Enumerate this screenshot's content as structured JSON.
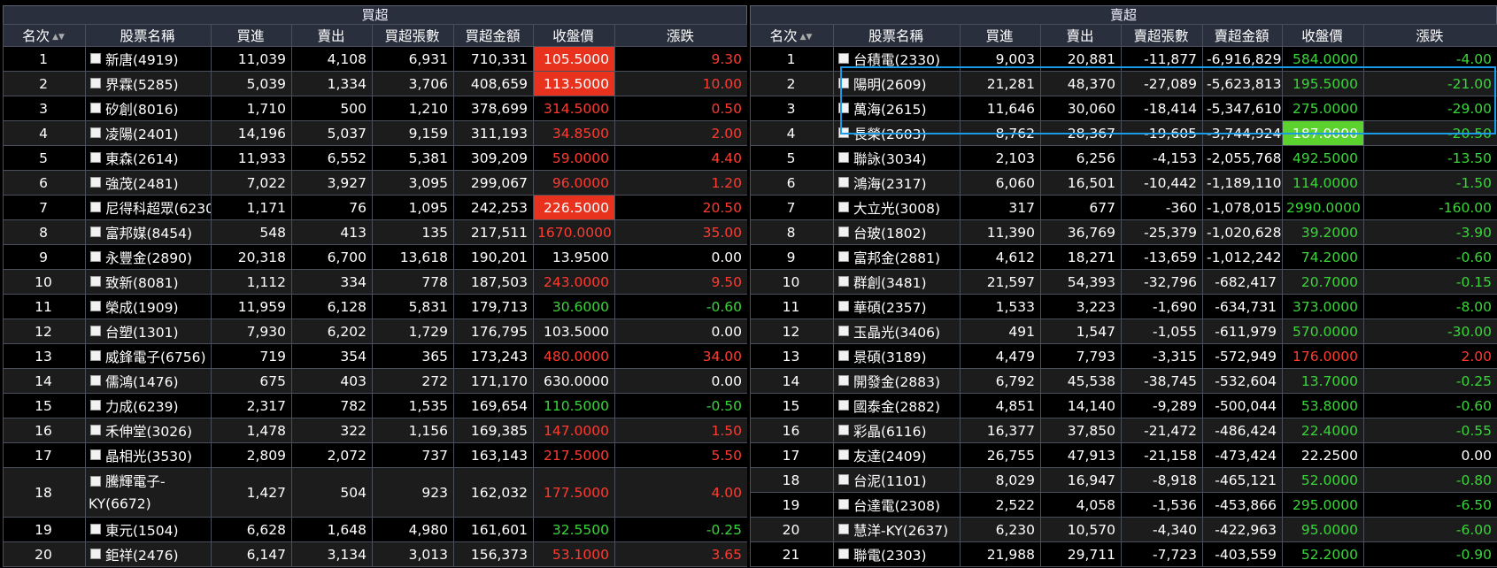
{
  "buy": {
    "title": "買超",
    "headers": [
      "名次",
      "股票名稱",
      "買進",
      "賣出",
      "買超張數",
      "買超金額",
      "收盤價",
      "漲跌"
    ],
    "rows": [
      {
        "rank": "1",
        "name": "新唐(4919)",
        "buy": "11,039",
        "sell": "4,108",
        "net": "6,931",
        "amount": "710,331",
        "close": "105.5000",
        "change": "9.30",
        "color": "red",
        "hl": true
      },
      {
        "rank": "2",
        "name": "界霖(5285)",
        "buy": "5,039",
        "sell": "1,334",
        "net": "3,706",
        "amount": "408,659",
        "close": "113.5000",
        "change": "10.00",
        "color": "red",
        "hl": true
      },
      {
        "rank": "3",
        "name": "矽創(8016)",
        "buy": "1,710",
        "sell": "500",
        "net": "1,210",
        "amount": "378,699",
        "close": "314.5000",
        "change": "0.50",
        "color": "red",
        "hl": false
      },
      {
        "rank": "4",
        "name": "凌陽(2401)",
        "buy": "14,196",
        "sell": "5,037",
        "net": "9,159",
        "amount": "311,193",
        "close": "34.8500",
        "change": "2.00",
        "color": "red",
        "hl": false
      },
      {
        "rank": "5",
        "name": "東森(2614)",
        "buy": "11,933",
        "sell": "6,552",
        "net": "5,381",
        "amount": "309,209",
        "close": "59.0000",
        "change": "4.40",
        "color": "red",
        "hl": false
      },
      {
        "rank": "6",
        "name": "強茂(2481)",
        "buy": "7,022",
        "sell": "3,927",
        "net": "3,095",
        "amount": "299,067",
        "close": "96.0000",
        "change": "1.20",
        "color": "red",
        "hl": false
      },
      {
        "rank": "7",
        "name": "尼得科超眾(6230)",
        "buy": "1,171",
        "sell": "76",
        "net": "1,095",
        "amount": "242,253",
        "close": "226.5000",
        "change": "20.50",
        "color": "red",
        "hl": true
      },
      {
        "rank": "8",
        "name": "富邦媒(8454)",
        "buy": "548",
        "sell": "413",
        "net": "135",
        "amount": "217,511",
        "close": "1670.0000",
        "change": "35.00",
        "color": "red",
        "hl": false
      },
      {
        "rank": "9",
        "name": "永豐金(2890)",
        "buy": "20,318",
        "sell": "6,700",
        "net": "13,618",
        "amount": "190,201",
        "close": "13.9500",
        "change": "0.00",
        "color": "white",
        "hl": false
      },
      {
        "rank": "10",
        "name": "致新(8081)",
        "buy": "1,112",
        "sell": "334",
        "net": "778",
        "amount": "187,503",
        "close": "243.0000",
        "change": "9.50",
        "color": "red",
        "hl": false
      },
      {
        "rank": "11",
        "name": "榮成(1909)",
        "buy": "11,959",
        "sell": "6,128",
        "net": "5,831",
        "amount": "179,713",
        "close": "30.6000",
        "change": "-0.60",
        "color": "green",
        "hl": false
      },
      {
        "rank": "12",
        "name": "台塑(1301)",
        "buy": "7,930",
        "sell": "6,202",
        "net": "1,729",
        "amount": "176,795",
        "close": "103.5000",
        "change": "0.00",
        "color": "white",
        "hl": false
      },
      {
        "rank": "13",
        "name": "威鋒電子(6756)",
        "buy": "719",
        "sell": "354",
        "net": "365",
        "amount": "173,243",
        "close": "480.0000",
        "change": "34.00",
        "color": "red",
        "hl": false
      },
      {
        "rank": "14",
        "name": "儒鴻(1476)",
        "buy": "675",
        "sell": "403",
        "net": "272",
        "amount": "171,170",
        "close": "630.0000",
        "change": "0.00",
        "color": "white",
        "hl": false
      },
      {
        "rank": "15",
        "name": "力成(6239)",
        "buy": "2,317",
        "sell": "782",
        "net": "1,535",
        "amount": "169,654",
        "close": "110.5000",
        "change": "-0.50",
        "color": "green",
        "hl": false
      },
      {
        "rank": "16",
        "name": "禾伸堂(3026)",
        "buy": "1,478",
        "sell": "322",
        "net": "1,156",
        "amount": "169,385",
        "close": "147.0000",
        "change": "1.50",
        "color": "red",
        "hl": false
      },
      {
        "rank": "17",
        "name": "晶相光(3530)",
        "buy": "2,809",
        "sell": "2,072",
        "net": "737",
        "amount": "163,143",
        "close": "217.5000",
        "change": "5.50",
        "color": "red",
        "hl": false
      },
      {
        "rank": "18",
        "name": "騰輝電子-KY(6672)",
        "name1": "騰輝電子-",
        "name2": "KY(6672)",
        "buy": "1,427",
        "sell": "504",
        "net": "923",
        "amount": "162,032",
        "close": "177.5000",
        "change": "4.00",
        "color": "red",
        "hl": false,
        "tall": true
      },
      {
        "rank": "19",
        "name": "東元(1504)",
        "buy": "6,628",
        "sell": "1,648",
        "net": "4,980",
        "amount": "161,601",
        "close": "32.5500",
        "change": "-0.25",
        "color": "green",
        "hl": false
      },
      {
        "rank": "20",
        "name": "鉅祥(2476)",
        "buy": "6,147",
        "sell": "3,134",
        "net": "3,013",
        "amount": "156,373",
        "close": "53.1000",
        "change": "3.65",
        "color": "red",
        "hl": false
      }
    ]
  },
  "sell": {
    "title": "賣超",
    "headers": [
      "名次",
      "股票名稱",
      "買進",
      "賣出",
      "賣超張數",
      "賣超金額",
      "收盤價",
      "漲跌"
    ],
    "rows": [
      {
        "rank": "1",
        "name": "台積電(2330)",
        "buy": "9,003",
        "sell": "20,881",
        "net": "-11,877",
        "amount": "-6,916,829",
        "close": "584.0000",
        "change": "-4.00",
        "color": "green",
        "hl": false
      },
      {
        "rank": "2",
        "name": "陽明(2609)",
        "buy": "21,281",
        "sell": "48,370",
        "net": "-27,089",
        "amount": "-5,623,813",
        "close": "195.5000",
        "change": "-21.00",
        "color": "green",
        "hl": false
      },
      {
        "rank": "3",
        "name": "萬海(2615)",
        "buy": "11,646",
        "sell": "30,060",
        "net": "-18,414",
        "amount": "-5,347,610",
        "close": "275.0000",
        "change": "-29.00",
        "color": "green",
        "hl": false
      },
      {
        "rank": "4",
        "name": "長榮(2603)",
        "buy": "8,762",
        "sell": "28,367",
        "net": "-19,605",
        "amount": "-3,744,924",
        "close": "187.0000",
        "change": "-20.50",
        "color": "green",
        "hl": true
      },
      {
        "rank": "5",
        "name": "聯詠(3034)",
        "buy": "2,103",
        "sell": "6,256",
        "net": "-4,153",
        "amount": "-2,055,768",
        "close": "492.5000",
        "change": "-13.50",
        "color": "green",
        "hl": false
      },
      {
        "rank": "6",
        "name": "鴻海(2317)",
        "buy": "6,060",
        "sell": "16,501",
        "net": "-10,442",
        "amount": "-1,189,110",
        "close": "114.0000",
        "change": "-1.50",
        "color": "green",
        "hl": false
      },
      {
        "rank": "7",
        "name": "大立光(3008)",
        "buy": "317",
        "sell": "677",
        "net": "-360",
        "amount": "-1,078,015",
        "close": "2990.0000",
        "change": "-160.00",
        "color": "green",
        "hl": false
      },
      {
        "rank": "8",
        "name": "台玻(1802)",
        "buy": "11,390",
        "sell": "36,769",
        "net": "-25,379",
        "amount": "-1,020,628",
        "close": "39.2000",
        "change": "-3.90",
        "color": "green",
        "hl": false
      },
      {
        "rank": "9",
        "name": "富邦金(2881)",
        "buy": "4,612",
        "sell": "18,271",
        "net": "-13,659",
        "amount": "-1,012,242",
        "close": "74.2000",
        "change": "-0.60",
        "color": "green",
        "hl": false
      },
      {
        "rank": "10",
        "name": "群創(3481)",
        "buy": "21,597",
        "sell": "54,393",
        "net": "-32,796",
        "amount": "-682,417",
        "close": "20.7000",
        "change": "-0.15",
        "color": "green",
        "hl": false
      },
      {
        "rank": "11",
        "name": "華碩(2357)",
        "buy": "1,533",
        "sell": "3,223",
        "net": "-1,690",
        "amount": "-634,731",
        "close": "373.0000",
        "change": "-8.00",
        "color": "green",
        "hl": false
      },
      {
        "rank": "12",
        "name": "玉晶光(3406)",
        "buy": "491",
        "sell": "1,547",
        "net": "-1,055",
        "amount": "-611,979",
        "close": "570.0000",
        "change": "-30.00",
        "color": "green",
        "hl": false
      },
      {
        "rank": "13",
        "name": "景碩(3189)",
        "buy": "4,479",
        "sell": "7,793",
        "net": "-3,315",
        "amount": "-572,949",
        "close": "176.0000",
        "change": "2.00",
        "color": "red",
        "hl": false
      },
      {
        "rank": "14",
        "name": "開發金(2883)",
        "buy": "6,792",
        "sell": "45,538",
        "net": "-38,745",
        "amount": "-532,604",
        "close": "13.7000",
        "change": "-0.25",
        "color": "green",
        "hl": false
      },
      {
        "rank": "15",
        "name": "國泰金(2882)",
        "buy": "4,851",
        "sell": "14,140",
        "net": "-9,289",
        "amount": "-500,044",
        "close": "53.8000",
        "change": "-0.60",
        "color": "green",
        "hl": false
      },
      {
        "rank": "16",
        "name": "彩晶(6116)",
        "buy": "16,377",
        "sell": "37,850",
        "net": "-21,472",
        "amount": "-486,424",
        "close": "22.4000",
        "change": "-0.55",
        "color": "green",
        "hl": false
      },
      {
        "rank": "17",
        "name": "友達(2409)",
        "buy": "26,755",
        "sell": "47,913",
        "net": "-21,158",
        "amount": "-473,424",
        "close": "22.2500",
        "change": "0.00",
        "color": "white",
        "hl": false
      },
      {
        "rank": "18",
        "name": "台泥(1101)",
        "buy": "8,029",
        "sell": "16,947",
        "net": "-8,918",
        "amount": "-465,121",
        "close": "52.0000",
        "change": "-0.80",
        "color": "green",
        "hl": false
      },
      {
        "rank": "19",
        "name": "台達電(2308)",
        "buy": "2,522",
        "sell": "4,058",
        "net": "-1,536",
        "amount": "-453,866",
        "close": "295.0000",
        "change": "-6.50",
        "color": "green",
        "hl": false
      },
      {
        "rank": "20",
        "name": "慧洋-KY(2637)",
        "buy": "6,230",
        "sell": "10,570",
        "net": "-4,340",
        "amount": "-422,963",
        "close": "95.0000",
        "change": "-6.00",
        "color": "green",
        "hl": false
      },
      {
        "rank": "21",
        "name": "聯電(2303)",
        "buy": "21,988",
        "sell": "29,711",
        "net": "-7,723",
        "amount": "-403,559",
        "close": "52.2000",
        "change": "-0.90",
        "color": "green",
        "hl": false
      }
    ]
  },
  "colors": {
    "up": "#ff3b30",
    "down": "#39d639",
    "flat": "#ffffff",
    "selection": "#1a9be8"
  }
}
